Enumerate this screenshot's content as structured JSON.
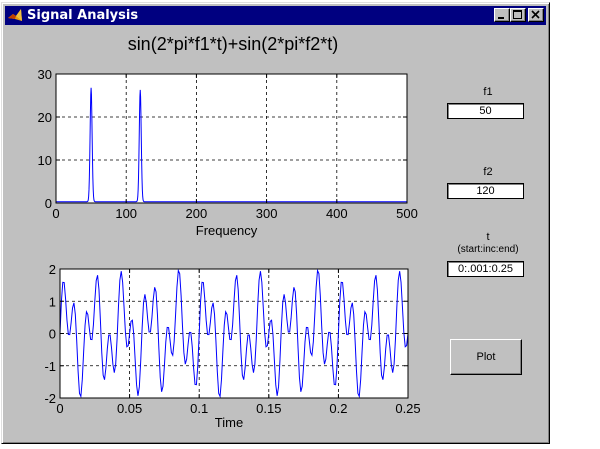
{
  "window": {
    "title": "Signal Analysis",
    "titlebar_color": "#000080",
    "face_color": "#c0c0c0"
  },
  "plot_title": "sin(2*pi*f1*t)+sin(2*pi*f2*t)",
  "controls": {
    "f1": {
      "label": "f1",
      "value": "50"
    },
    "f2": {
      "label": "f2",
      "value": "120"
    },
    "t": {
      "label": "t",
      "sublabel": "(start:inc:end)",
      "value": "0:.001:0.25"
    },
    "plot_button": "Plot"
  },
  "chart_data": [
    {
      "type": "line",
      "xlabel": "Frequency",
      "ylabel": "",
      "xlim": [
        0,
        500
      ],
      "ylim": [
        0,
        30
      ],
      "xticks": [
        0,
        100,
        200,
        300,
        400,
        500
      ],
      "yticks": [
        0,
        10,
        20,
        30
      ],
      "grid": true,
      "line_color": "#0000ff",
      "peaks": [
        {
          "x": 50,
          "y": 26.5
        },
        {
          "x": 120,
          "y": 26
        }
      ],
      "baseline": 0.3
    },
    {
      "type": "line",
      "xlabel": "Time",
      "ylabel": "",
      "xlim": [
        0,
        0.25
      ],
      "ylim": [
        -2,
        2
      ],
      "xticks": [
        0,
        0.05,
        0.1,
        0.15,
        0.2,
        0.25
      ],
      "yticks": [
        -2,
        -1,
        0,
        1,
        2
      ],
      "grid": true,
      "line_color": "#0000ff",
      "function": "sin(2*pi*50*t)+sin(2*pi*120*t)",
      "t_step": 0.001
    }
  ],
  "icons": {
    "app": "matlab-logo-icon",
    "minimize": "minimize-icon",
    "maximize": "maximize-icon",
    "close": "close-icon"
  }
}
